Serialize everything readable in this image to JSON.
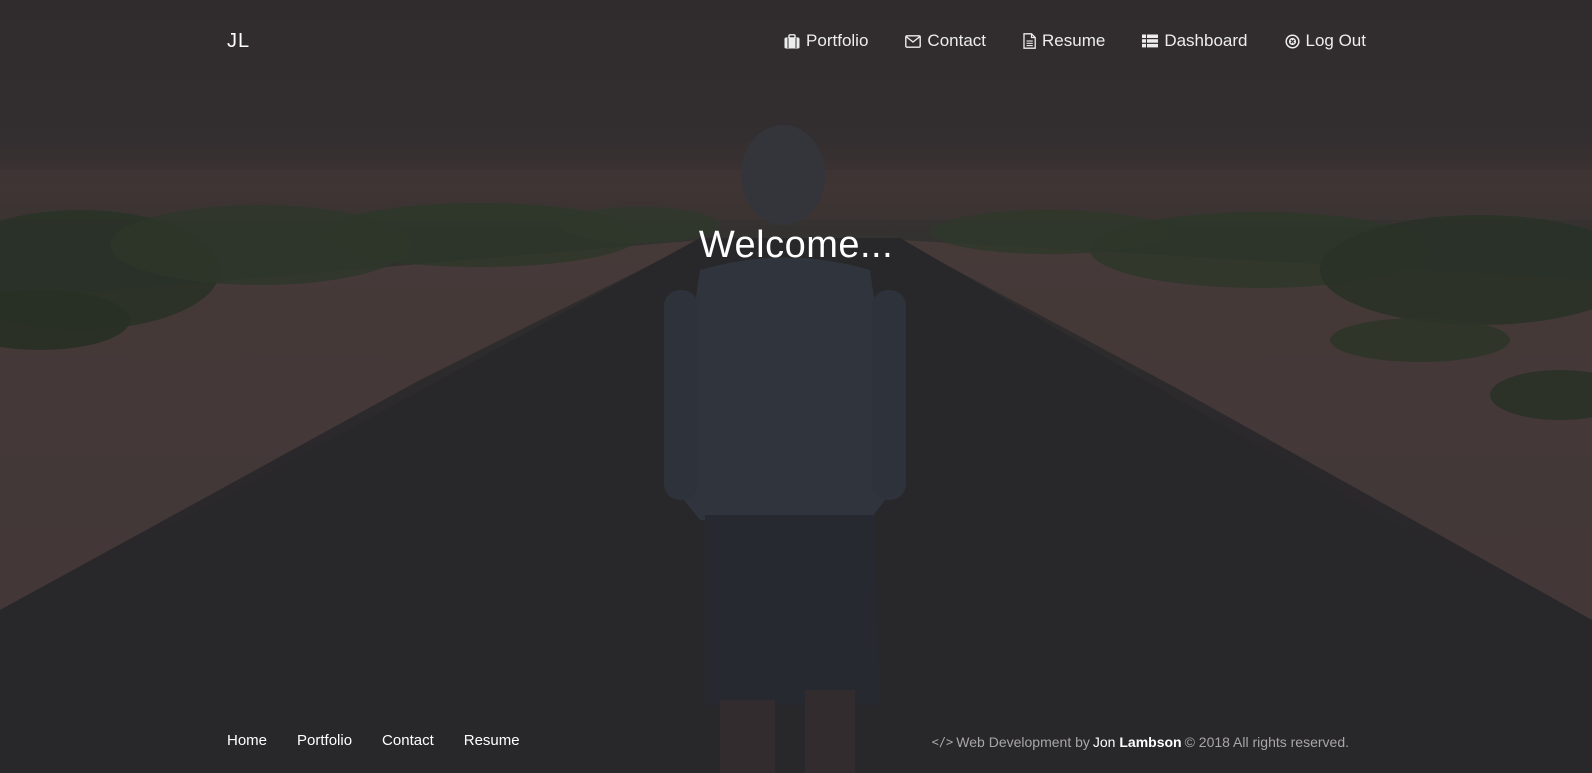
{
  "brand": "JL",
  "nav": {
    "portfolio": "Portfolio",
    "contact": "Contact",
    "resume": "Resume",
    "dashboard": "Dashboard",
    "logout": "Log Out"
  },
  "hero": {
    "title": "Welcome..."
  },
  "footer": {
    "links": {
      "home": "Home",
      "portfolio": "Portfolio",
      "contact": "Contact",
      "resume": "Resume"
    },
    "credit": {
      "code_glyph": "</>",
      "prefix": "Web Development by",
      "first_name": "Jon",
      "last_name": "Lambson",
      "suffix": "© 2018 All rights reserved."
    }
  },
  "icons": {
    "portfolio": "briefcase-icon",
    "contact": "envelope-icon",
    "resume": "file-text-icon",
    "dashboard": "list-icon",
    "logout": "close-circle-icon",
    "credit": "code-icon"
  }
}
